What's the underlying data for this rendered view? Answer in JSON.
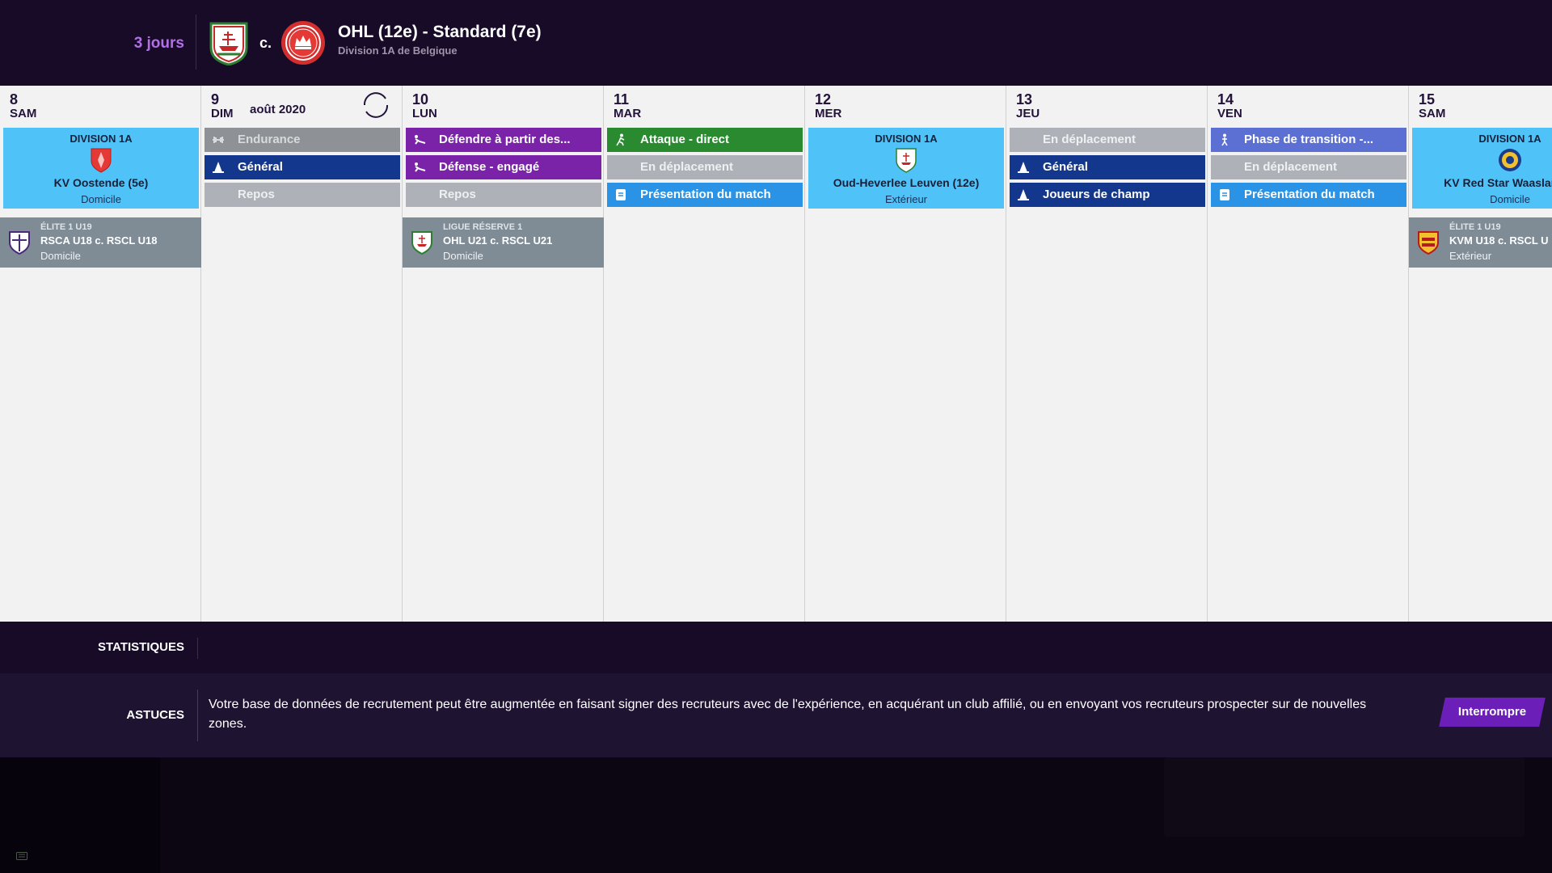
{
  "header": {
    "countdown": "3 jours",
    "versus": "c.",
    "match_title": "OHL (12e) - Standard (7e)",
    "competition": "Division 1A de Belgique",
    "home_crest": "ohl-crest-icon",
    "away_crest": "standard-crest-icon"
  },
  "calendar": {
    "month": "août 2020",
    "days": [
      {
        "num": "8",
        "name": "SAM",
        "match": {
          "comp": "DIVISION 1A",
          "team": "KV Oostende (5e)",
          "venue": "Domicile",
          "icon": "kv-oostende-crest-icon"
        },
        "youth": {
          "comp": "ÉLITE 1 U19",
          "match": "RSCA U18 c. RSCL U18",
          "venue": "Domicile",
          "icon": "rsca-crest-icon"
        }
      },
      {
        "num": "9",
        "name": "DIM",
        "sessions": [
          {
            "label": "Endurance",
            "color": "#8e9196",
            "icon": "dumbbell-icon"
          },
          {
            "label": "Général",
            "color": "#13378c",
            "icon": "cone-icon"
          },
          {
            "label": "Repos",
            "color": "#aeb2b8",
            "icon": ""
          }
        ]
      },
      {
        "num": "10",
        "name": "LUN",
        "sessions": [
          {
            "label": "Défendre à partir des...",
            "color": "#7a22a8",
            "icon": "slide-tackle-icon"
          },
          {
            "label": "Défense - engagé",
            "color": "#7a22a8",
            "icon": "slide-tackle-icon"
          },
          {
            "label": "Repos",
            "color": "#aeb2b8",
            "icon": ""
          }
        ],
        "youth": {
          "comp": "LIGUE RÉSERVE 1",
          "match": "OHL U21 c. RSCL U21",
          "venue": "Domicile",
          "icon": "ohl-crest-icon"
        }
      },
      {
        "num": "11",
        "name": "MAR",
        "sessions": [
          {
            "label": "Attaque - direct",
            "color": "#2a8a30",
            "icon": "running-player-icon"
          },
          {
            "label": "En déplacement",
            "color": "#aeb2b8",
            "icon": ""
          },
          {
            "label": "Présentation du match",
            "color": "#2a93e6",
            "icon": "clipboard-icon"
          }
        ]
      },
      {
        "num": "12",
        "name": "MER",
        "match": {
          "comp": "DIVISION 1A",
          "team": "Oud-Heverlee Leuven (12e)",
          "venue": "Extérieur",
          "icon": "ohl-crest-icon"
        }
      },
      {
        "num": "13",
        "name": "JEU",
        "sessions": [
          {
            "label": "En déplacement",
            "color": "#aeb2b8",
            "icon": ""
          },
          {
            "label": "Général",
            "color": "#13378c",
            "icon": "cone-icon"
          },
          {
            "label": "Joueurs de champ",
            "color": "#13378c",
            "icon": "cone-icon"
          }
        ]
      },
      {
        "num": "14",
        "name": "VEN",
        "sessions": [
          {
            "label": "Phase de transition -...",
            "color": "#5c6fd3",
            "icon": "walking-player-icon"
          },
          {
            "label": "En déplacement",
            "color": "#aeb2b8",
            "icon": ""
          },
          {
            "label": "Présentation du match",
            "color": "#2a93e6",
            "icon": "clipboard-icon"
          }
        ]
      },
      {
        "num": "15",
        "name": "SAM",
        "match": {
          "comp": "DIVISION 1A",
          "team": "KV Red Star Waasland-S",
          "venue": "Domicile",
          "icon": "waasland-crest-icon"
        },
        "youth": {
          "comp": "ÉLITE 1 U19",
          "match": "KVM U18 c. RSCL U",
          "venue": "Extérieur",
          "icon": "kvm-crest-icon"
        }
      }
    ]
  },
  "stats": {
    "label": "STATISTIQUES"
  },
  "tips": {
    "label": "ASTUCES",
    "text": "Votre base de données de recrutement peut être augmentée en faisant signer des recruteurs avec de l'expérience, en acquérant un club affilié, ou en envoyant vos recruteurs prospecter sur de nouvelles zones.",
    "button": "Interrompre"
  }
}
